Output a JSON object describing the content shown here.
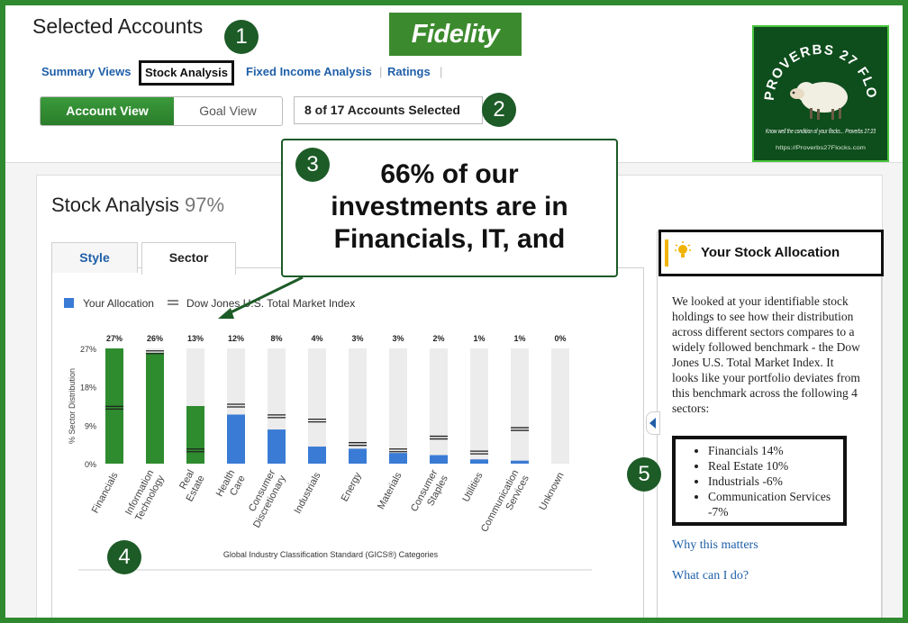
{
  "header": {
    "title": "Selected Accounts",
    "logo": "Fidelity",
    "tabs": [
      {
        "label": "Summary Views",
        "active": false
      },
      {
        "label": "Stock Analysis",
        "active": true
      },
      {
        "label": "Fixed Income Analysis",
        "active": false
      },
      {
        "label": "Ratings",
        "active": false
      }
    ],
    "view_buttons": {
      "account": "Account View",
      "goal": "Goal View",
      "selected": "Account View"
    },
    "accounts_selected": "8 of 17 Accounts Selected"
  },
  "badge": {
    "title": "PROVERBS 27 FLOCKS",
    "tagline": "Know well the condition of your flocks... Proverbs 27:23",
    "url": "https://Proverbs27Flocks.com"
  },
  "markers": [
    "1",
    "2",
    "3",
    "4",
    "5"
  ],
  "callout": {
    "text": "66% of our investments are in Financials, IT, and"
  },
  "analysis": {
    "title": "Stock Analysis",
    "percent": "97%",
    "tabs": [
      {
        "label": "Style",
        "active": false
      },
      {
        "label": "Sector",
        "active": true
      }
    ]
  },
  "chart_data": {
    "type": "bar",
    "legend": [
      "Your Allocation",
      "Dow Jones U.S. Total Market Index"
    ],
    "ylabel": "% Sector Distribution",
    "xlabel": "Global Industry Classification Standard (GICS®) Categories",
    "yticks": [
      "27%",
      "18%",
      "9%",
      "0%"
    ],
    "ylim": [
      0,
      27
    ],
    "categories": [
      "Financials",
      "Information Technology",
      "Real Estate",
      "Health Care",
      "Consumer Discretionary",
      "Industrials",
      "Energy",
      "Materials",
      "Consumer Staples",
      "Utilities",
      "Communication Services",
      "Unknown"
    ],
    "category_lines": [
      [
        "Financials"
      ],
      [
        "Information",
        "Technology"
      ],
      [
        "Real",
        "Estate"
      ],
      [
        "Health",
        "Care"
      ],
      [
        "Consumer",
        "Discretionary"
      ],
      [
        "Industrials"
      ],
      [
        "Energy"
      ],
      [
        "Materials"
      ],
      [
        "Consumer",
        "Staples"
      ],
      [
        "Utilities"
      ],
      [
        "Communication",
        "Services"
      ],
      [
        "Unknown"
      ]
    ],
    "value_labels": [
      "27%",
      "26%",
      "13%",
      "12%",
      "8%",
      "4%",
      "3%",
      "3%",
      "2%",
      "1%",
      "1%",
      "0%"
    ],
    "your_allocation": [
      27,
      26,
      13.5,
      11.5,
      8,
      4,
      3.5,
      2.5,
      2,
      1,
      0.7,
      0
    ],
    "your_allocation_colors": [
      "#2e8b2e",
      "#2e8b2e",
      "#2e8b2e",
      "#3a7bd5",
      "#3a7bd5",
      "#3a7bd5",
      "#3a7bd5",
      "#3a7bd5",
      "#3a7bd5",
      "#3a7bd5",
      "#3a7bd5",
      "#3a7bd5"
    ],
    "index": [
      13,
      26,
      3,
      13.5,
      11,
      10,
      4.5,
      3,
      6,
      2.5,
      8,
      0
    ]
  },
  "allocation_panel": {
    "title": "Your Stock Allocation",
    "icon": "lightbulb-icon",
    "text": "We looked at your identifiable stock holdings to see how their distribution across different sectors compares to a widely followed benchmark - the Dow Jones U.S. Total Market Index. It looks like your portfolio deviates from this benchmark across the following 4 sectors:",
    "items": [
      "Financials 14%",
      "Real Estate 10%",
      "Industrials -6%",
      "Communication Services -7%"
    ],
    "links": [
      "Why this matters",
      "What can I do?"
    ]
  },
  "colors": {
    "brand_green": "#3c8a2e",
    "allocation_blue": "#3a7bd5",
    "allocation_green": "#2e8b2e",
    "marker_green": "#1d5b27",
    "link_blue": "#1f5fa8"
  }
}
